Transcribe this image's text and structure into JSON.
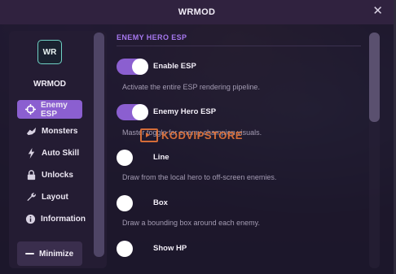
{
  "window": {
    "title": "WRMOD",
    "close_glyph": "✕"
  },
  "sidebar": {
    "logo_text": "WR",
    "brand": "WRMOD",
    "items": [
      {
        "label": "Enemy ESP",
        "icon": "crosshair-icon",
        "active": true
      },
      {
        "label": "Monsters",
        "icon": "dragon-icon",
        "active": false
      },
      {
        "label": "Auto Skill",
        "icon": "lightning-icon",
        "active": false
      },
      {
        "label": "Unlocks",
        "icon": "lock-icon",
        "active": false
      },
      {
        "label": "Layout",
        "icon": "wrench-icon",
        "active": false
      },
      {
        "label": "Information",
        "icon": "info-icon",
        "active": false
      }
    ],
    "minimize_label": "Minimize"
  },
  "main": {
    "section_title": "ENEMY HERO ESP",
    "options": [
      {
        "label": "Enable ESP",
        "desc": "Activate the entire ESP rendering pipeline.",
        "on": true
      },
      {
        "label": "Enemy Hero ESP",
        "desc": "Master toggle for enemy champion visuals.",
        "on": true
      },
      {
        "label": "Line",
        "desc": "Draw from the local hero to off-screen enemies.",
        "on": false
      },
      {
        "label": "Box",
        "desc": "Draw a bounding box around each enemy.",
        "on": false
      },
      {
        "label": "Show HP",
        "desc": "",
        "on": false
      }
    ]
  },
  "watermark": {
    "text": "KODVIPSTORE"
  },
  "colors": {
    "accent": "#8b5fd0",
    "section_title": "#a678ef",
    "watermark": "#e8763a"
  }
}
